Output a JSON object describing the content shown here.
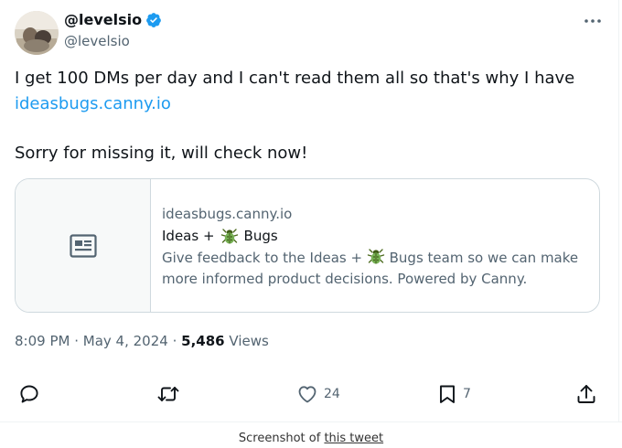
{
  "tweet": {
    "display_name": "@levelsio",
    "handle": "@levelsio",
    "line1": "I get 100 DMs per day and I can't read them all so that's why I have",
    "link": "ideasbugs.canny.io",
    "line3": "Sorry for missing it, will check now!",
    "card": {
      "domain": "ideasbugs.canny.io",
      "title_pre": "Ideas + ",
      "title_post": "Bugs",
      "desc_pre": "Give feedback to the Ideas + ",
      "desc_post": "Bugs team so we can make",
      "desc_line2": "more informed product decisions. Powered by Canny."
    },
    "time": "8:09 PM",
    "date": "May 4, 2024",
    "views_count": "5,486",
    "views_label": "Views",
    "likes": "24",
    "bookmarks": "7"
  },
  "footer": {
    "prefix": "Screenshot of ",
    "link": "this tweet"
  },
  "icons": [
    "avatar-photo",
    "verified-badge-icon",
    "more-icon",
    "article-icon",
    "bug-emoji",
    "reply-icon",
    "retweet-icon",
    "like-icon",
    "bookmark-icon",
    "share-icon"
  ],
  "colors": {
    "accent": "#1d9bf0",
    "text": "#0f1419",
    "muted": "#536471",
    "border": "#cfd9de"
  }
}
